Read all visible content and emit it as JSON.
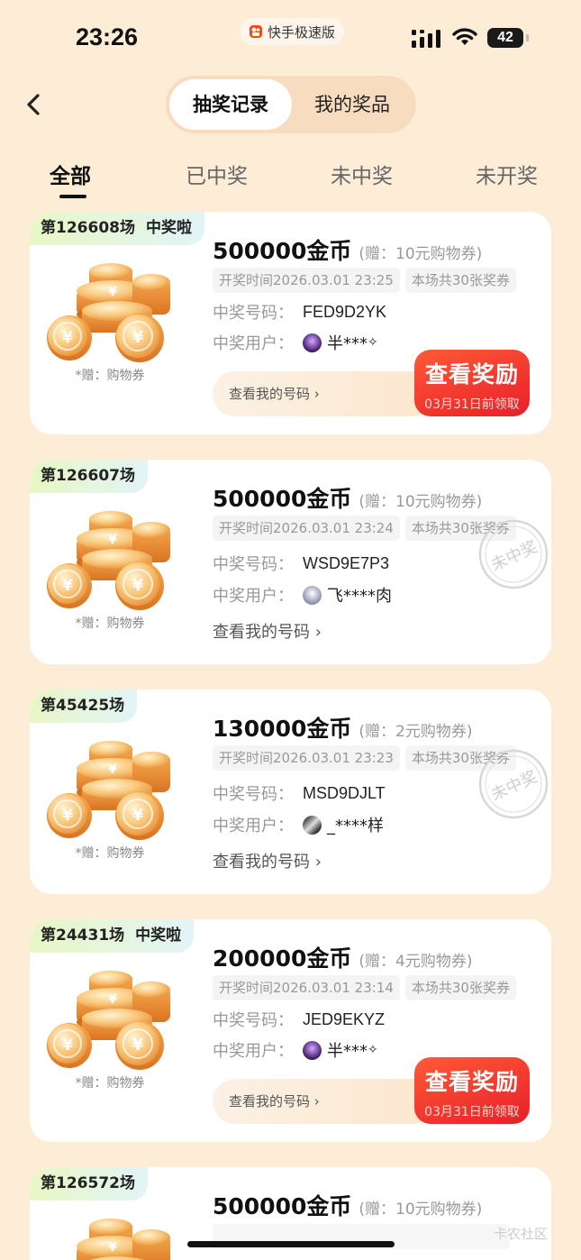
{
  "status_bar": {
    "time": "23:26",
    "app_name": "快手极速版",
    "battery": "42"
  },
  "header": {
    "tabs": [
      {
        "label": "抽奖记录",
        "active": true
      },
      {
        "label": "我的奖品",
        "active": false
      }
    ]
  },
  "filters": [
    {
      "label": "全部",
      "active": true
    },
    {
      "label": "已中奖"
    },
    {
      "label": "未中奖"
    },
    {
      "label": "未开奖"
    }
  ],
  "cards": [
    {
      "session": "第126608场",
      "win_badge": "中奖啦",
      "amount": "500000金币",
      "gift": "(赠：10元购物券)",
      "draw_time": "开奖时间2026.03.01 23:25",
      "tickets": "本场共30张奖券",
      "code_label": "中奖号码：",
      "code": "FED9D2YK",
      "user_label": "中奖用户：",
      "user": "半***",
      "link": "查看我的号码 ›",
      "claim_title": "查看奖励",
      "claim_deadline": "03月31日前领取",
      "gift_caption": "*赠：购物券"
    },
    {
      "session": "第126607场",
      "amount": "500000金币",
      "gift": "(赠：10元购物券)",
      "draw_time": "开奖时间2026.03.01 23:24",
      "tickets": "本场共30张奖券",
      "code_label": "中奖号码：",
      "code": "WSD9E7P3",
      "user_label": "中奖用户：",
      "user": "飞****肉",
      "link": "查看我的号码 ›",
      "stamp": "未中奖",
      "gift_caption": "*赠：购物券"
    },
    {
      "session": "第45425场",
      "amount": "130000金币",
      "gift": "(赠：2元购物券)",
      "draw_time": "开奖时间2026.03.01 23:23",
      "tickets": "本场共30张奖券",
      "code_label": "中奖号码：",
      "code": "MSD9DJLT",
      "user_label": "中奖用户：",
      "user": "_****样",
      "link": "查看我的号码 ›",
      "stamp": "未中奖",
      "gift_caption": "*赠：购物券"
    },
    {
      "session": "第24431场",
      "win_badge": "中奖啦",
      "amount": "200000金币",
      "gift": "(赠：4元购物券)",
      "draw_time": "开奖时间2026.03.01 23:14",
      "tickets": "本场共30张奖券",
      "code_label": "中奖号码：",
      "code": "JED9EKYZ",
      "user_label": "中奖用户：",
      "user": "半***",
      "link": "查看我的号码 ›",
      "claim_title": "查看奖励",
      "claim_deadline": "03月31日前领取",
      "gift_caption": "*赠：购物券"
    },
    {
      "session": "第126572场",
      "amount": "500000金币",
      "gift": "(赠：10元购物券)"
    }
  ],
  "watermark": "卡农社区",
  "colors": {
    "background": "#fdecd6",
    "claim_button": "#ee2a2a",
    "badge_green": "#e8f7c4"
  }
}
